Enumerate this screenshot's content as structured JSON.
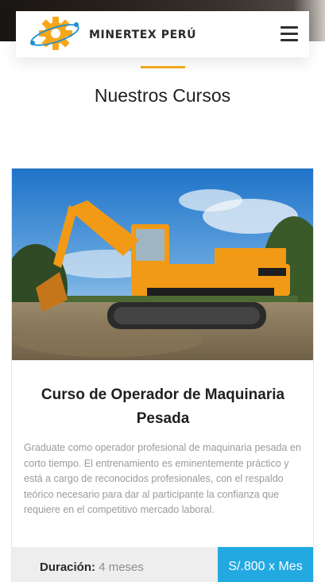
{
  "header": {
    "brand": "MINERTEX PERÚ",
    "logo_icon": "gear-orbit-logo",
    "menu_icon": "hamburger-menu-icon"
  },
  "section": {
    "title": "Nuestros Cursos"
  },
  "course": {
    "image_alt": "excavator-photo",
    "title": "Curso de Operador de Maquinaria Pesada",
    "description": "Graduate como operador profesional de maquinaria pesada en corto tiempo. El entrenamiento es eminentemente práctico y está a cargo de reconocidos profesionales, con el respaldo teórico necesario para dar al participante la confianza que requiere en el competitivo mercado laboral.",
    "duration_label": "Duración:",
    "duration_value": "4 meses",
    "price": "S/.800 x Mes"
  },
  "colors": {
    "accent": "#f0a81a",
    "price_bg": "#23a9e2",
    "logo_gear": "#f5a71b",
    "logo_ring": "#1f8fd1"
  }
}
